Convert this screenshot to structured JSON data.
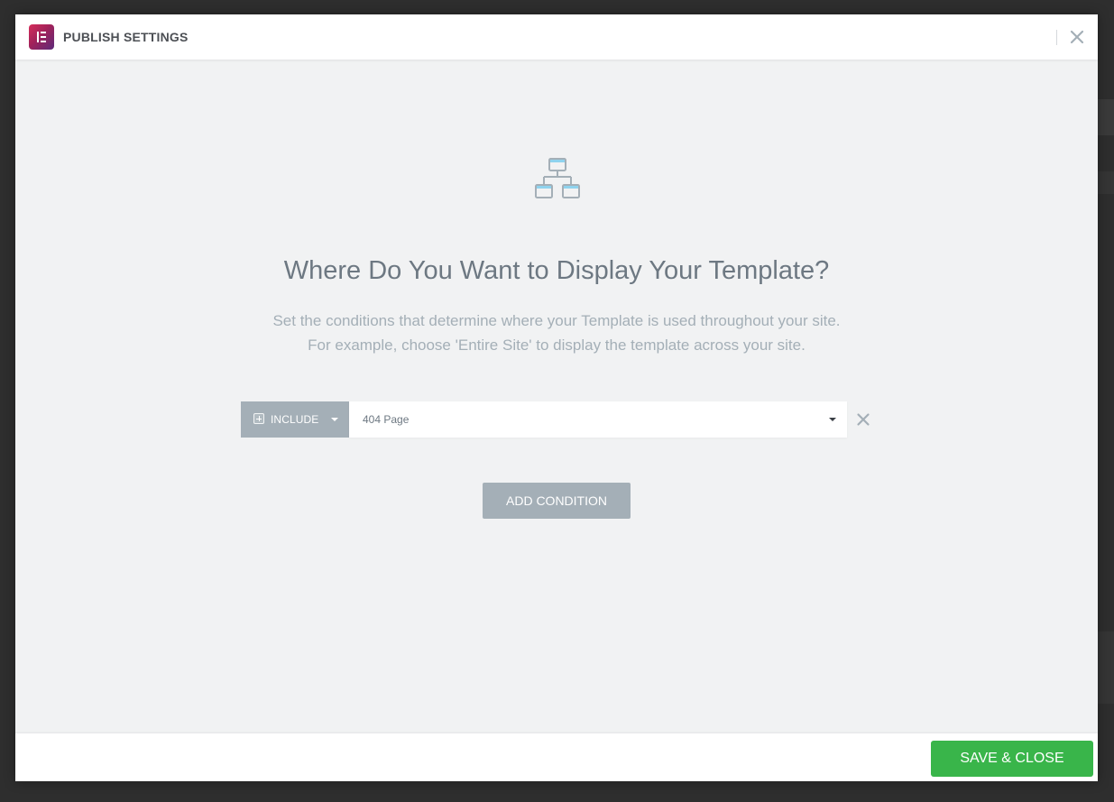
{
  "modal": {
    "title": "PUBLISH SETTINGS",
    "close_icon": "close-icon",
    "logo_icon": "elementor-logo-icon"
  },
  "main": {
    "icon": "sitemap-icon",
    "headline": "Where Do You Want to Display Your Template?",
    "description_line1": "Set the conditions that determine where your Template is used throughout your site.",
    "description_line2": "For example, choose 'Entire Site' to display the template across your site."
  },
  "condition": {
    "type_label": "INCLUDE",
    "type_icon": "plus-square-icon",
    "selected_value": "404 Page",
    "remove_icon": "close-icon"
  },
  "actions": {
    "add_condition_label": "ADD CONDITION",
    "save_close_label": "SAVE & CLOSE"
  },
  "colors": {
    "accent_green": "#39b54a",
    "muted_button": "#a4afb7",
    "heading_text": "#6d7882",
    "description_text": "#a4afb7",
    "logo_gradient_start": "#d62d5a",
    "logo_gradient_end": "#5c2a7a"
  }
}
